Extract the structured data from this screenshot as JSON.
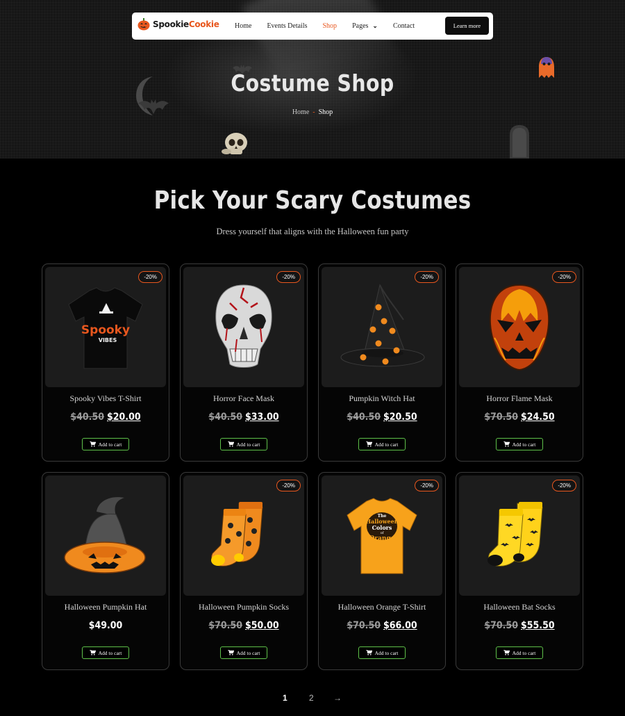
{
  "brand": {
    "name_part1": "Spookie",
    "name_part2": "Cookie"
  },
  "nav": {
    "links": [
      "Home",
      "Events Details",
      "Shop",
      "Pages",
      "Contact"
    ],
    "active": "Shop",
    "cta": "Learn more"
  },
  "hero": {
    "title": "Costume Shop",
    "breadcrumb": {
      "home": "Home",
      "separator": "-",
      "current": "Shop"
    }
  },
  "section": {
    "title": "Pick Your Scary Costumes",
    "subtitle": "Dress yourself that aligns with the Halloween fun party"
  },
  "products": [
    {
      "name": "Spooky Vibes T-Shirt",
      "old_price": "$40.50",
      "price": "$20.00",
      "discount": "-20%",
      "image": "black-tshirt-spooky-vibes"
    },
    {
      "name": "Horror Face Mask",
      "old_price": "$40.50",
      "price": "$33.00",
      "discount": "-20%",
      "image": "bloody-skull-mask"
    },
    {
      "name": "Pumpkin Witch Hat",
      "old_price": "$40.50",
      "price": "$20.50",
      "discount": "-20%",
      "image": "black-witch-hat-pumpkins"
    },
    {
      "name": "Horror Flame Mask",
      "old_price": "$70.50",
      "price": "$24.50",
      "discount": "-20%",
      "image": "flame-pumpkin-mask"
    },
    {
      "name": "Halloween Pumpkin Hat",
      "old_price": "",
      "price": "$49.00",
      "discount": "",
      "image": "pumpkin-witch-hat"
    },
    {
      "name": "Halloween Pumpkin Socks",
      "old_price": "$70.50",
      "price": "$50.00",
      "discount": "-20%",
      "image": "orange-pumpkin-socks"
    },
    {
      "name": "Halloween Orange T-Shirt",
      "old_price": "$70.50",
      "price": "$66.00",
      "discount": "-20%",
      "image": "orange-tshirt"
    },
    {
      "name": "Halloween Bat Socks",
      "old_price": "$70.50",
      "price": "$55.50",
      "discount": "-20%",
      "image": "yellow-bat-socks"
    }
  ],
  "cart_label": "Add to cart",
  "pagination": {
    "pages": [
      "1",
      "2"
    ],
    "active": "1",
    "next": "→"
  },
  "tshirt_print": {
    "line1": "Spooky",
    "line2": "VIBES"
  },
  "orange_tshirt_print": {
    "line1": "The",
    "line2": "Halloween",
    "line3": "Colors",
    "line4": "of",
    "line5": "Orange"
  },
  "colors": {
    "accent": "#e8571e",
    "cart_border": "#5fc24a",
    "card_bg": "#1c1c1c",
    "page_bg": "#000000"
  }
}
